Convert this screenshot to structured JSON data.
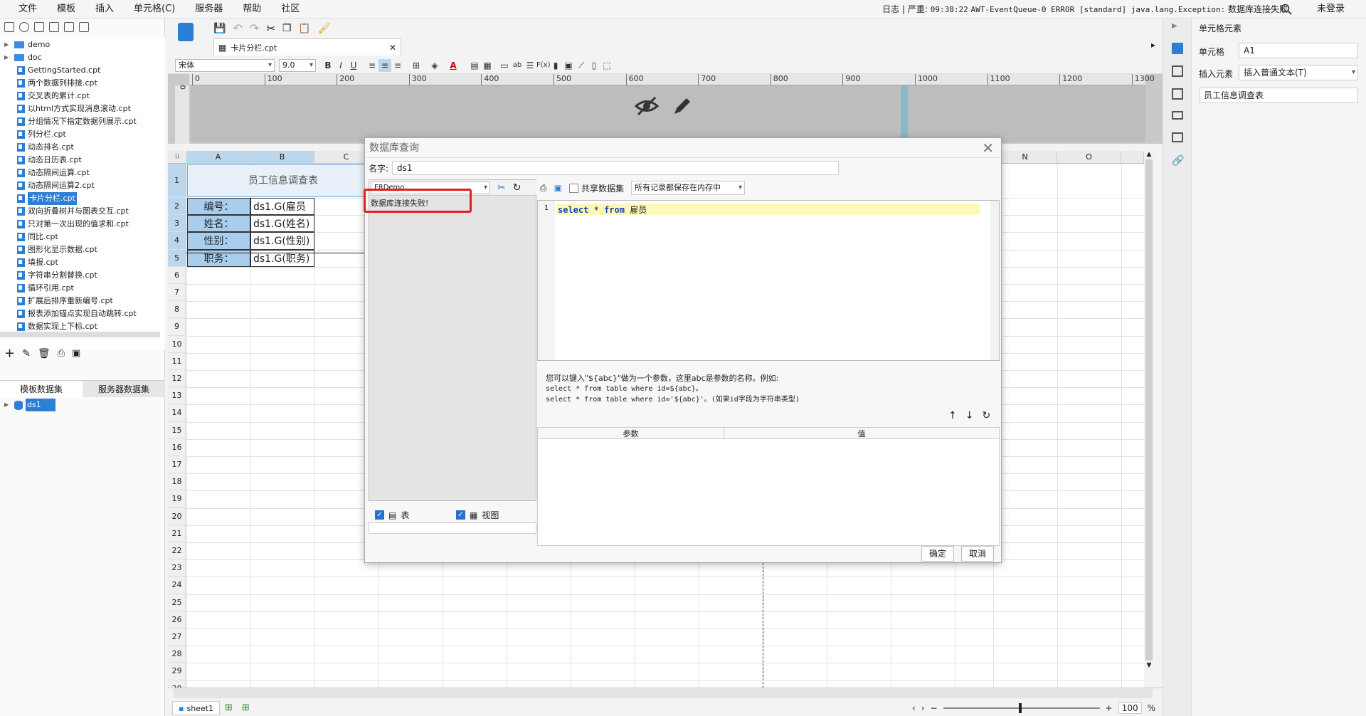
{
  "menu": [
    "文件",
    "模板",
    "插入",
    "单元格(C)",
    "服务器",
    "帮助",
    "社区"
  ],
  "log": {
    "label": "日志",
    "sep": "|",
    "level": "严重",
    "time": "09:38:22",
    "message": "AWT-EventQueue-0 ERROR [standard] java.lang.Exception:",
    "cn": "数据库连接失败"
  },
  "login": "未登录",
  "tree": {
    "folders": [
      "demo",
      "doc"
    ],
    "files": [
      "GettingStarted.cpt",
      "两个数据列排接.cpt",
      "交叉表的累计.cpt",
      "以html方式实现消息滚动.cpt",
      "分组情况下指定数据列展示.cpt",
      "列分栏.cpt",
      "动态排名.cpt",
      "动态日历表.cpt",
      "动态隔间运算.cpt",
      "动态隔间运算2.cpt",
      "卡片分栏.cpt",
      "双向折叠树并与图表交互.cpt",
      "只对第一次出现的值求和.cpt",
      "同比.cpt",
      "图形化显示数据.cpt",
      "填报.cpt",
      "字符串分割替换.cpt",
      "循环引用.cpt",
      "扩展后排序重新编号.cpt",
      "报表添加锚点实现自动跳转.cpt",
      "数据实现上下标.cpt"
    ],
    "selected": "卡片分栏.cpt"
  },
  "lefttabs": [
    "模板数据集",
    "服务器数据集"
  ],
  "datasets": [
    "ds1"
  ],
  "doc_tab": "卡片分栏.cpt",
  "font": {
    "name": "宋体",
    "size": "9.0"
  },
  "ruler": [
    "0",
    "100",
    "200",
    "300",
    "400",
    "500",
    "600",
    "700",
    "800",
    "900",
    "1000",
    "1100",
    "1200",
    "1300"
  ],
  "columns": [
    "A",
    "B",
    "C",
    "N",
    "O"
  ],
  "rows": [
    "1",
    "2",
    "3",
    "4",
    "5",
    "6",
    "7",
    "8",
    "9",
    "10",
    "11",
    "12",
    "13",
    "14",
    "15",
    "16",
    "17",
    "18",
    "19",
    "20",
    "21",
    "22",
    "23",
    "24",
    "25",
    "26",
    "27",
    "28",
    "29",
    "30"
  ],
  "sheet": {
    "title": "员工信息调查表",
    "labels": [
      "编号：",
      "姓名：",
      "性别：",
      "职务："
    ],
    "values": [
      "ds1.G(雇员",
      "ds1.G(姓名)",
      "ds1.G(性别)",
      "ds1.G(职务)"
    ]
  },
  "sheet_tab": "sheet1",
  "zoom": "100",
  "zoom_unit": "%",
  "right": {
    "title": "单元格元素",
    "cell_label": "单元格",
    "cell_value": "A1",
    "insert_label": "插入元素",
    "insert_value": "插入普通文本(T)",
    "content": "员工信息调查表"
  },
  "dialog": {
    "title": "数据库查询",
    "name_label": "名字:",
    "name_value": "ds1",
    "connection": "FRDemo",
    "error": "数据库连接失败!",
    "share_label": "共享数据集",
    "cache_option": "所有记录都保存在内存中",
    "sql_lineno": "1",
    "sql_kw1": "select",
    "sql_star": "*",
    "sql_kw2": "from",
    "sql_table": "雇员",
    "hint1": "您可以键入\"${abc}\"做为一个参数，这里abc是参数的名称。例如:",
    "hint2": "select * from table where id=${abc}。",
    "hint3": "select * from table where id='${abc}'。(如果id字段为字符串类型)",
    "param_col": "参数",
    "value_col": "值",
    "table_chk": "表",
    "view_chk": "视图",
    "ok": "确定",
    "cancel": "取消"
  }
}
